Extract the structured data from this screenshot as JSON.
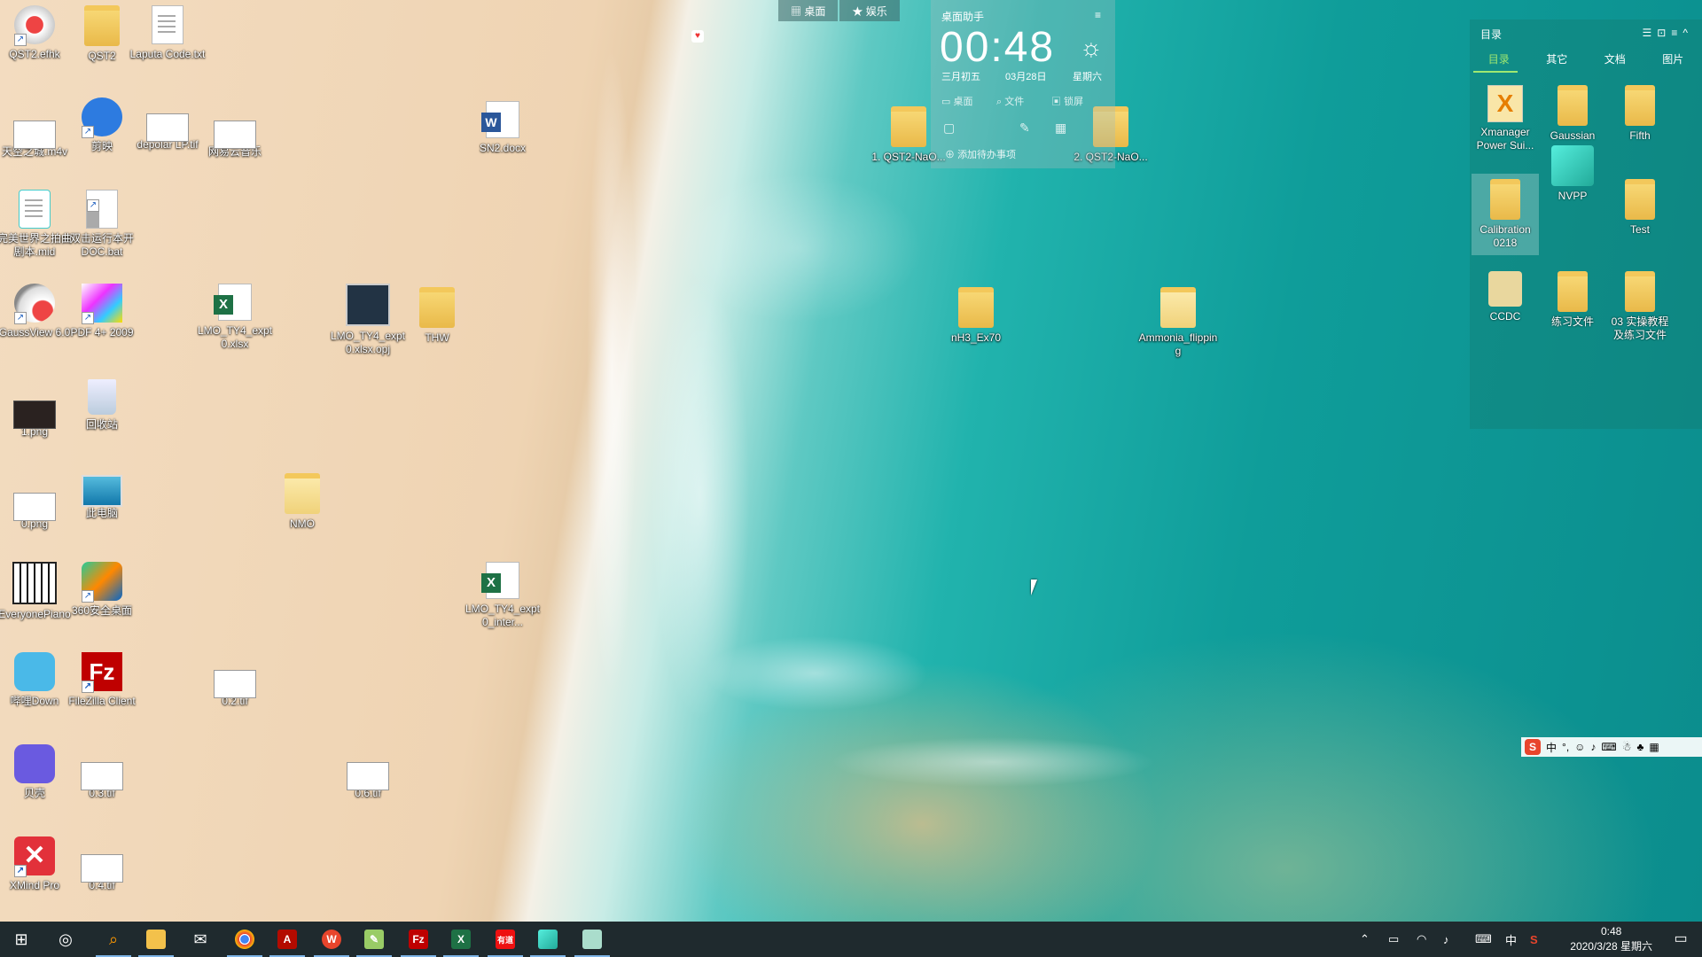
{
  "desktop_icons": [
    {
      "label": "QST2.efhk"
    },
    {
      "label": "QST2"
    },
    {
      "label": "Laputa Code.txt"
    },
    {
      "label": "天空之城.m4v"
    },
    {
      "label": "剪映"
    },
    {
      "label": "depolar LP.tif"
    },
    {
      "label": "网易云音乐"
    },
    {
      "label": "SN2.docx"
    },
    {
      "label": "完美世界之拍曲剧本.mid"
    },
    {
      "label": "双击运行本开DOC.bat"
    },
    {
      "label": "GaussView 6.0"
    },
    {
      "label": "PDF 4+ 2009"
    },
    {
      "label": "LMO_TY4_expt0.xlsx"
    },
    {
      "label": "LMO_TY4_expt0.xlsx.opj"
    },
    {
      "label": "THW"
    },
    {
      "label": "1.png"
    },
    {
      "label": "回收站"
    },
    {
      "label": "0.png"
    },
    {
      "label": "此电脑"
    },
    {
      "label": "NMO"
    },
    {
      "label": "EveryonePiano"
    },
    {
      "label": "360安全桌面"
    },
    {
      "label": "LMO_TY4_expt0_inter..."
    },
    {
      "label": "哔哩Down"
    },
    {
      "label": "FileZilla Client"
    },
    {
      "label": "0.2.tif"
    },
    {
      "label": "贝壳"
    },
    {
      "label": "0.3.tif"
    },
    {
      "label": "0.6.tif"
    },
    {
      "label": "XMind Pro"
    },
    {
      "label": "0.4.tif"
    },
    {
      "label": "1. QST2-NaO..."
    },
    {
      "label": "2. QST2-NaO..."
    },
    {
      "label": "nH3_Ex70"
    },
    {
      "label": "Ammonia_flipping"
    }
  ],
  "tabs": {
    "desktop": "桌面",
    "entertainment": "娱乐"
  },
  "clock": {
    "title": "桌面助手",
    "time": "00:48",
    "lunar": "三月初五",
    "date": "03月28日",
    "weekday": "星期六",
    "tool_desktop": "桌面",
    "tool_file": "文件",
    "tool_lock": "锁屏",
    "note": "添加待办事项"
  },
  "catalog": {
    "title": "目录",
    "tabs": [
      "目录",
      "其它",
      "文档",
      "图片"
    ],
    "items": [
      {
        "label": "Xmanager Power Sui..."
      },
      {
        "label": "Gaussian"
      },
      {
        "label": "Fifth"
      },
      {
        "label": "Calibration 0218"
      },
      {
        "label": "NVPP"
      },
      {
        "label": "Test"
      },
      {
        "label": "CCDC"
      },
      {
        "label": "练习文件"
      },
      {
        "label": "03 实操教程及练习文件"
      }
    ]
  },
  "ime": {
    "lang": "中"
  },
  "taskbar": {
    "clock_time": "0:48",
    "clock_date": "2020/3/28 星期六",
    "ime_lang": "中",
    "apps": [
      "start",
      "cortana",
      "search",
      "file-explorer",
      "mail",
      "chrome",
      "acrobat",
      "wps",
      "notepad",
      "filezilla",
      "excel",
      "youdao",
      "gaussview",
      "notes"
    ]
  },
  "colors": {
    "taskbar": "#1f2a2e",
    "accent": "#9fe870"
  }
}
